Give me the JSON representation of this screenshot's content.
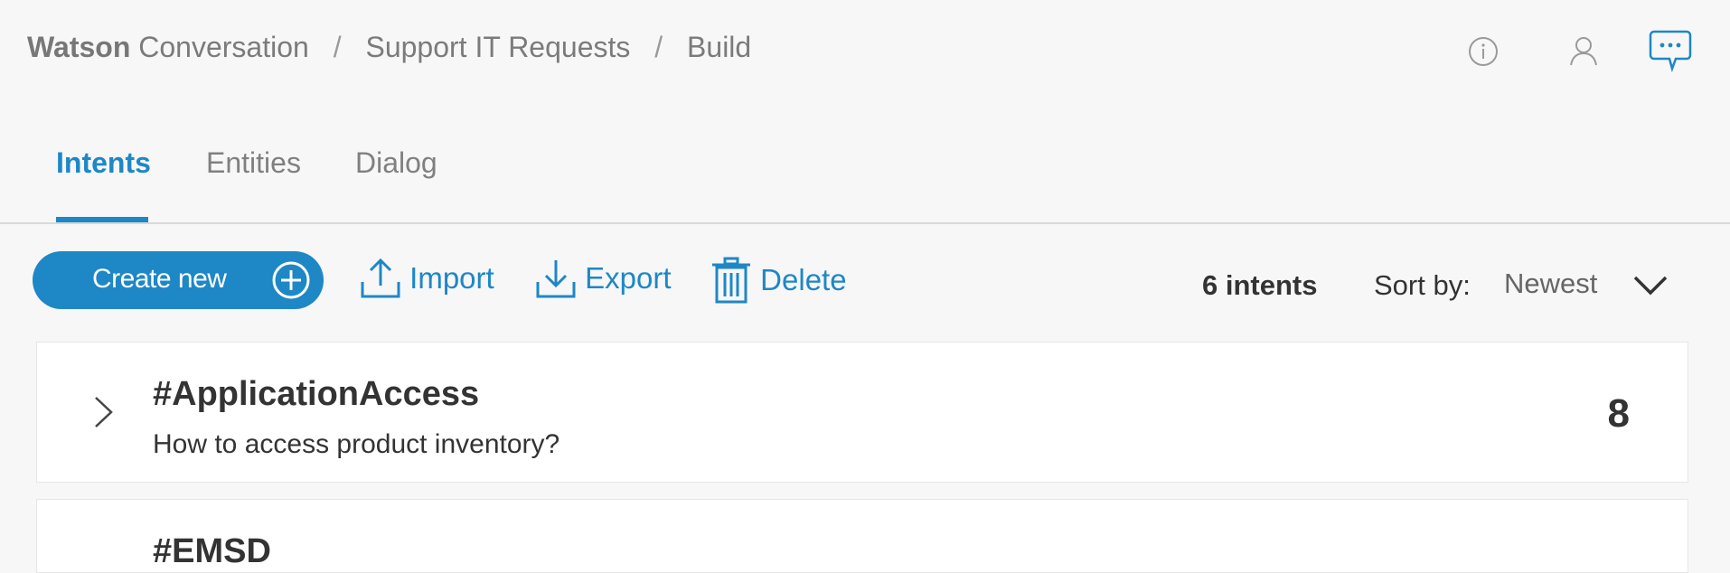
{
  "header": {
    "brand_bold": "Watson",
    "brand_rest": "Conversation",
    "separator": "/",
    "crumbs": [
      "Support IT Requests",
      "Build"
    ],
    "icons": [
      "info-icon",
      "user-icon",
      "chat-icon"
    ]
  },
  "tabs": [
    {
      "label": "Intents",
      "active": true
    },
    {
      "label": "Entities",
      "active": false
    },
    {
      "label": "Dialog",
      "active": false
    }
  ],
  "toolbar": {
    "create_label": "Create new",
    "import_label": "Import",
    "export_label": "Export",
    "delete_label": "Delete",
    "count_label": "6 intents",
    "sort_label": "Sort by:",
    "sort_value": "Newest"
  },
  "intents": [
    {
      "name": "#ApplicationAccess",
      "example": "How to access product inventory?",
      "count": "8"
    },
    {
      "name": "#EMSD"
    }
  ],
  "colors": {
    "accent": "#1e87c6",
    "background": "#f7f7f7",
    "text": "#333333"
  }
}
